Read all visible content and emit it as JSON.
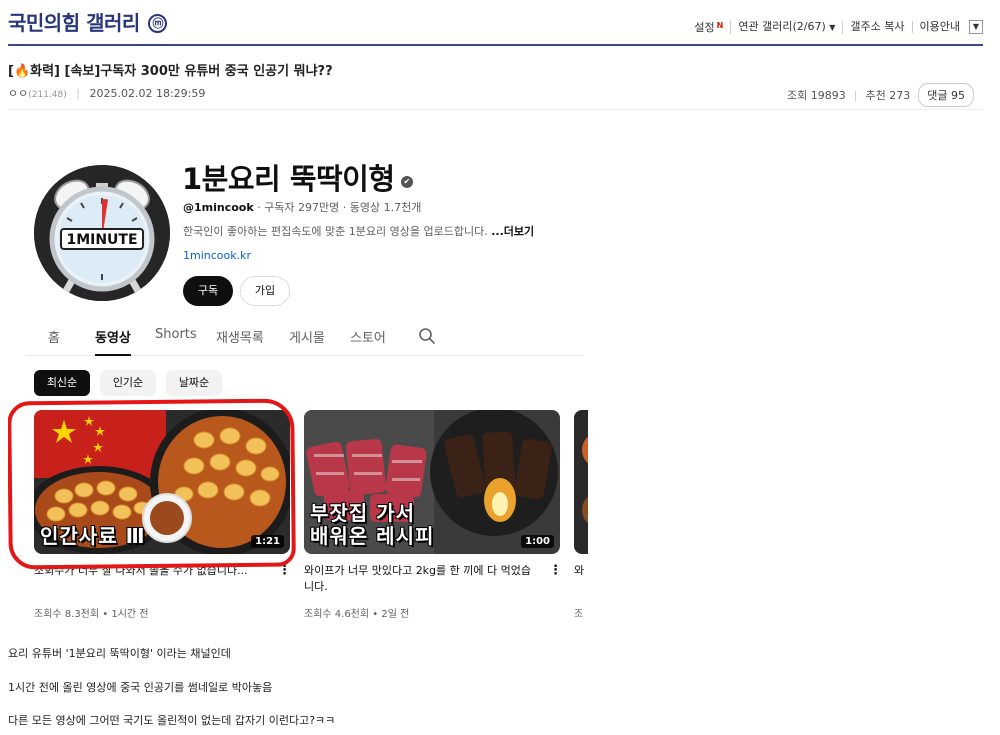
{
  "gallery": {
    "title": "국민의힘 갤러리",
    "badge": "ⓜ",
    "menu": {
      "settings": "설정",
      "settings_new": "N",
      "related": "연관 갤러리(2/67)",
      "copy_url": "갤주소 복사",
      "guide": "이용안내"
    }
  },
  "post": {
    "tag": "[🔥화력]",
    "title": "[속보]구독자 300만 유튜버 중국 인공기 뭐냐??",
    "author": "ㅇㅇ",
    "ip": "(211.48)",
    "datetime": "2025.02.02 18:29:59",
    "views_label": "조회",
    "views": "19893",
    "recommend_label": "추천",
    "recommend": "273",
    "reply_label": "댓글",
    "reply": "95"
  },
  "channel": {
    "avatar_text": "1MINUTE",
    "name": "1분요리 뚝딱이형",
    "verified_icon": "✔",
    "handle": "@1mincook",
    "stats": " · 구독자 297만명 · 동영상 1.7천개",
    "description": "한국인이 좋아하는 편집속도에 맞춘 1분요리 영상을 업로드합니다. ",
    "more": "...더보기",
    "link": "1mincook.kr",
    "subscribe": "구독",
    "join": "가입"
  },
  "tabs": [
    "홈",
    "동영상",
    "Shorts",
    "재생목록",
    "게시물",
    "스토어"
  ],
  "chips": [
    "최신순",
    "인기순",
    "날짜순"
  ],
  "videos": [
    {
      "overlay": "인간사료 Ⅲ",
      "duration": "1:21",
      "title": "조회수가 너무 잘 나와서 솔을 수가 없습니다...",
      "meta": "조회수 8.3천회 • 1시간 전"
    },
    {
      "overlay1": "부잣집 가서",
      "overlay2": "배워온 레시피",
      "duration": "1:00",
      "title": "와이프가 너무 맛있다고 2kg를 한 끼에 다 먹었습니다.",
      "meta": "조회수 4.6천회 • 2일 전"
    },
    {
      "title": "와",
      "meta": "조"
    }
  ],
  "body": [
    "요리 유튜버 '1분요리 뚝딱이형' 이라는 채널인데",
    "1시간 전에 올린 영상에 중국 인공기를 썸네일로 박아놓음",
    "다른 모든 영상에 그어떤 국기도 올린적이 없는데 갑자기 이런다고?ㅋㅋ"
  ],
  "colors": {
    "gallery_blue": "#29367c",
    "highlight_red": "#e51616",
    "link_blue": "#065fd4"
  }
}
